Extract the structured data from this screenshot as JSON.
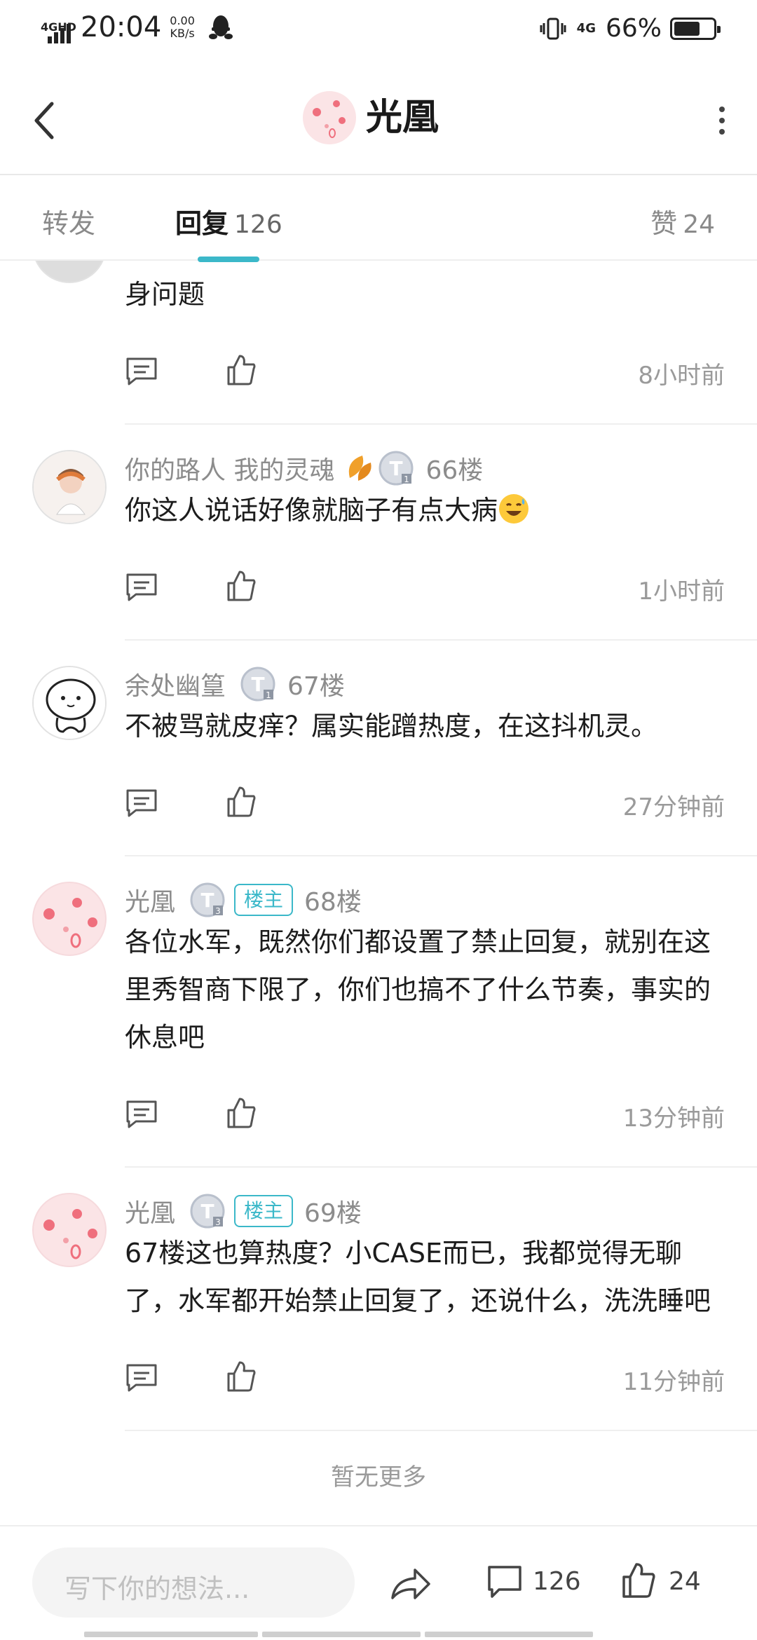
{
  "status_bar": {
    "network": "4GHD",
    "time": "20:04",
    "speed_value": "0.00",
    "speed_unit": "KB/s",
    "cell": "4G",
    "battery": "66%",
    "battery_level": 0.66
  },
  "header": {
    "title": "光凰"
  },
  "tabs": {
    "forward": "转发",
    "reply": "回复",
    "reply_count": "126",
    "like": "赞",
    "like_count": "24"
  },
  "comments": [
    {
      "text": "真要管服务器的事就好了，这种情况明显是游戏本身问题",
      "time": "8小时前"
    },
    {
      "name": "你的路人  我的灵魂",
      "floor": "66楼",
      "text": "你这人说话好像就脑子有点大病",
      "time": "1小时前"
    },
    {
      "name": "余处幽篁",
      "floor": "67楼",
      "text": "不被骂就皮痒？属实能蹭热度，在这抖机灵。",
      "time": "27分钟前"
    },
    {
      "name": "光凰",
      "owner": "楼主",
      "floor": "68楼",
      "text": "各位水军，既然你们都设置了禁止回复，就别在这里秀智商下限了，你们也搞不了什么节奏，事实的休息吧",
      "time": "13分钟前"
    },
    {
      "name": "光凰",
      "owner": "楼主",
      "floor": "69楼",
      "text": "67楼这也算热度？小CASE而已，我都觉得无聊了，水军都开始禁止回复了，还说什么，洗洗睡吧",
      "time": "11分钟前"
    }
  ],
  "no_more": "暂无更多",
  "bottom_bar": {
    "placeholder": "写下你的想法...",
    "comment_count": "126",
    "like_count": "24"
  },
  "colors": {
    "accent": "#3bb8c9",
    "avatar_pink": "#fbe4e6",
    "muted_text": "#8c8c8c"
  },
  "icons": [
    "back-icon",
    "more-icon",
    "reply-icon",
    "like-icon",
    "share-icon",
    "comment-icon",
    "level-badge",
    "leaf-icon",
    "emoji-sweat-smile"
  ]
}
